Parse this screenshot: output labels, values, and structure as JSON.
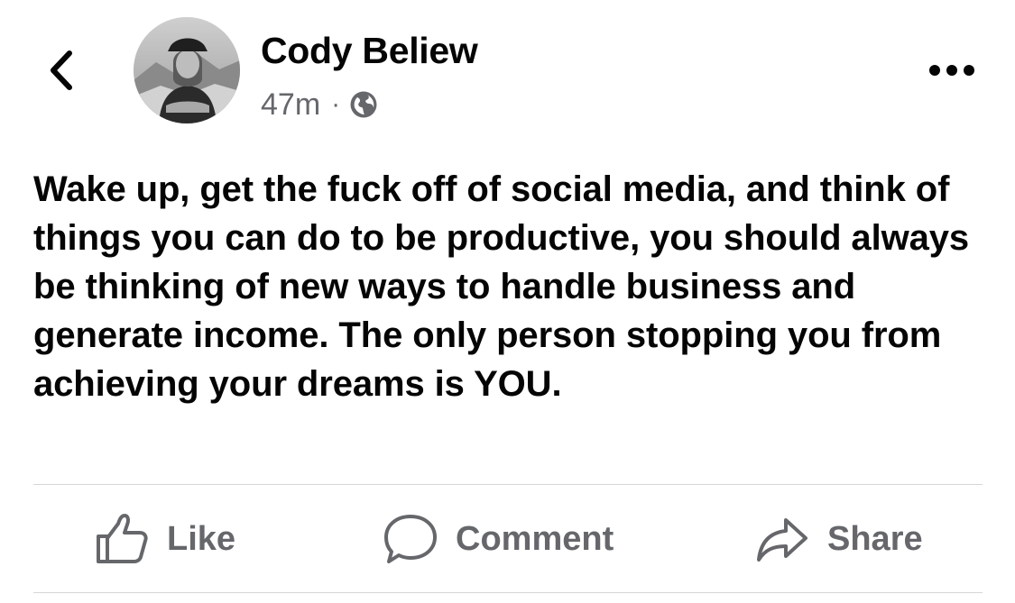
{
  "header": {
    "back_icon": "chevron-left-icon",
    "author_name": "Cody Beliew",
    "timestamp": "47m",
    "separator": "·",
    "privacy_icon": "globe-icon",
    "more_icon": "more-horizontal-icon"
  },
  "post": {
    "text": "Wake up, get the fuck off of social media, and think of things you can do to be productive, you should always be thinking of new ways to handle business and generate income. The only person stopping you from achieving your dreams is YOU."
  },
  "actions": [
    {
      "label": "Like",
      "icon": "thumbs-up-icon"
    },
    {
      "label": "Comment",
      "icon": "speech-bubble-icon"
    },
    {
      "label": "Share",
      "icon": "share-arrow-icon"
    }
  ],
  "colors": {
    "text": "#050505",
    "secondary": "#65676b",
    "divider": "#d6d6d6",
    "background": "#ffffff"
  }
}
